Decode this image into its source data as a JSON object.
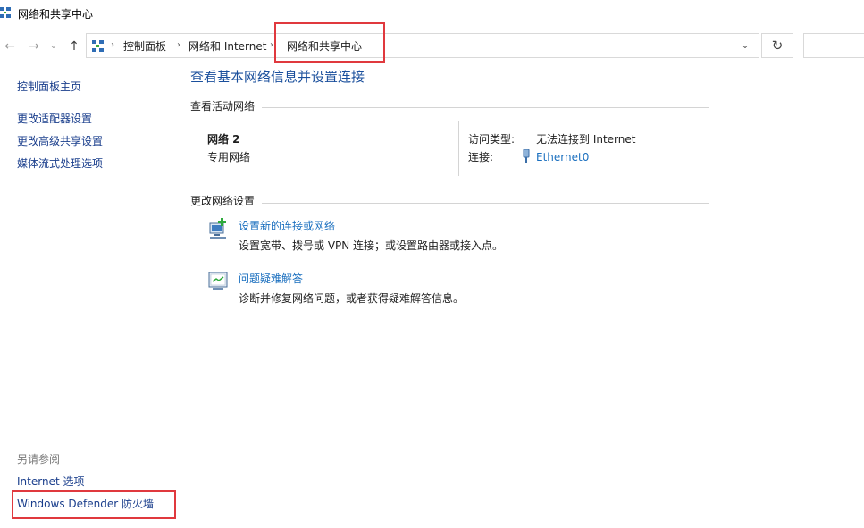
{
  "window": {
    "title": "网络和共享中心"
  },
  "nav": {
    "back_glyph": "←",
    "forward_glyph": "→",
    "recent_glyph": "⌄",
    "up_glyph": "↑"
  },
  "address": {
    "sep": "›",
    "crumbs": [
      "控制面板",
      "网络和 Internet",
      "网络和共享中心"
    ],
    "dropdown_glyph": "⌄",
    "refresh_glyph": "↻"
  },
  "sidebar": {
    "home": "控制面板主页",
    "links": [
      "更改适配器设置",
      "更改高级共享设置",
      "媒体流式处理选项"
    ],
    "see_also_title": "另请参阅",
    "see_also": [
      "Internet 选项",
      "Windows Defender 防火墙"
    ]
  },
  "main": {
    "title": "查看基本网络信息并设置连接",
    "active_networks_heading": "查看活动网络",
    "network": {
      "name": "网络 2",
      "category": "专用网络",
      "access_label": "访问类型:",
      "access_value": "无法连接到 Internet",
      "connection_label": "连接:",
      "connection_value": "Ethernet0"
    },
    "change_heading": "更改网络设置",
    "tasks": [
      {
        "title": "设置新的连接或网络",
        "desc": "设置宽带、拨号或 VPN 连接；或设置路由器或接入点。",
        "icon": "new-connection-icon"
      },
      {
        "title": "问题疑难解答",
        "desc": "诊断并修复网络问题，或者获得疑难解答信息。",
        "icon": "troubleshoot-icon"
      }
    ]
  },
  "colors": {
    "link": "#1a6fbf",
    "title": "#1a4f9c",
    "highlight": "#e0393e"
  }
}
